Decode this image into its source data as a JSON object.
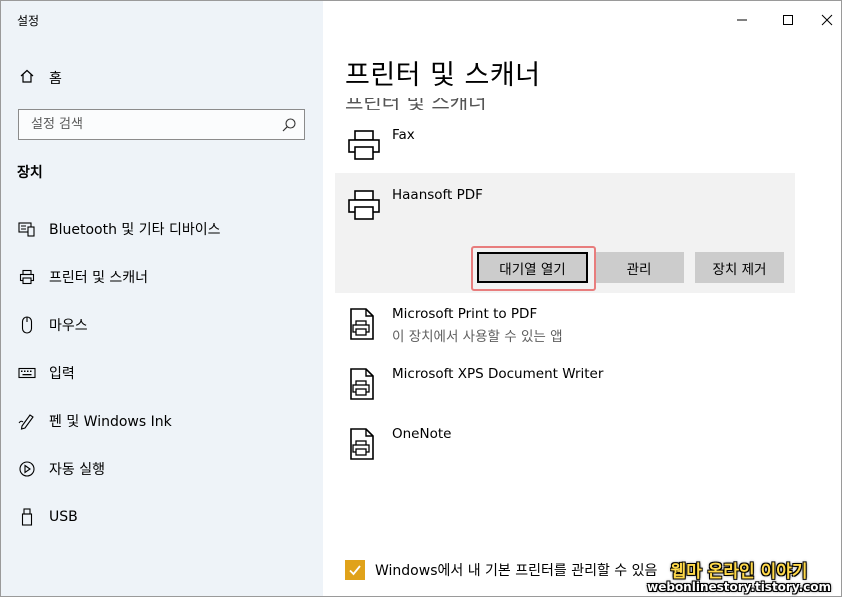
{
  "window": {
    "title": "설정",
    "controls": {
      "minimize": "minimize-icon",
      "maximize": "maximize-icon",
      "close": "close-icon"
    }
  },
  "sidebar": {
    "home_label": "홈",
    "search_placeholder": "설정 검색",
    "section_title": "장치",
    "items": [
      {
        "label": "Bluetooth 및 기타 디바이스",
        "icon": "bluetooth-devices-icon"
      },
      {
        "label": "프린터 및 스캐너",
        "icon": "printer-icon"
      },
      {
        "label": "마우스",
        "icon": "mouse-icon"
      },
      {
        "label": "입력",
        "icon": "keyboard-icon"
      },
      {
        "label": "펜 및 Windows Ink",
        "icon": "pen-icon"
      },
      {
        "label": "자동 실행",
        "icon": "autoplay-icon"
      },
      {
        "label": "USB",
        "icon": "usb-icon"
      }
    ]
  },
  "main": {
    "title": "프린터 및 스캐너",
    "title_ghost": "프린터 및 스캐너",
    "printers": [
      {
        "name": "Fax",
        "sub": ""
      },
      {
        "name": "Haansoft PDF",
        "sub": ""
      },
      {
        "name": "Microsoft Print to PDF",
        "sub": "이 장치에서 사용할 수 있는 앱"
      },
      {
        "name": "Microsoft XPS Document Writer",
        "sub": ""
      },
      {
        "name": "OneNote",
        "sub": ""
      }
    ],
    "buttons": {
      "open_queue": "대기열 열기",
      "manage": "관리",
      "remove": "장치 제거"
    },
    "checkbox_label": "Windows에서 내 기본 프린터를 관리할 수 있음",
    "accent_color": "#e0a21a"
  },
  "watermark": {
    "line1": "웹마 온라인 이야기",
    "line2": "webonlinestory.tistory.com"
  }
}
